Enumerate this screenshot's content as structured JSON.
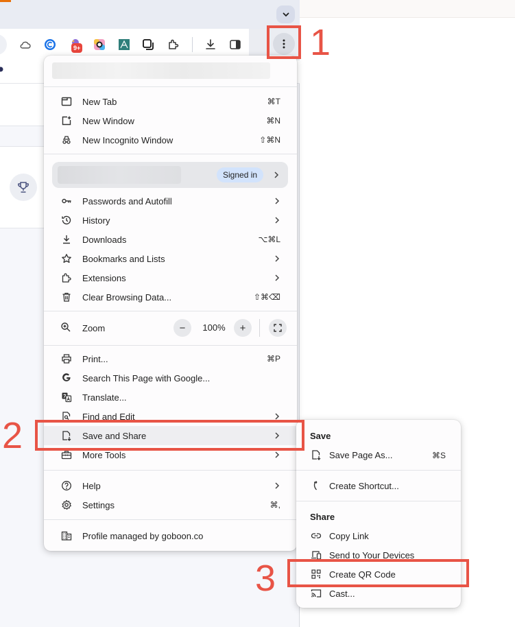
{
  "browser": {
    "tab_badge": "9+",
    "colors": {
      "annotation": "#e85446",
      "signed_pill": "#d2e3fc",
      "tab_accent": "#e8710a"
    }
  },
  "toolbar_icons": [
    "cloud-icon",
    "c-extension-icon",
    "notification-extension-icon",
    "color-picker-extension-icon",
    "asana-like-extension-icon",
    "window-copy-icon",
    "puzzle-extensions-icon",
    "download-icon",
    "side-panel-icon",
    "kebab-menu-icon"
  ],
  "menu": {
    "items_top": [
      {
        "label": "New Tab",
        "shortcut": "⌘T"
      },
      {
        "label": "New Window",
        "shortcut": "⌘N"
      },
      {
        "label": "New Incognito Window",
        "shortcut": "⇧⌘N"
      }
    ],
    "signed_in": "Signed in",
    "items_mid": [
      {
        "label": "Passwords and Autofill",
        "shortcut": ""
      },
      {
        "label": "History",
        "shortcut": ""
      },
      {
        "label": "Downloads",
        "shortcut": "⌥⌘L"
      },
      {
        "label": "Bookmarks and Lists",
        "shortcut": ""
      },
      {
        "label": "Extensions",
        "shortcut": ""
      },
      {
        "label": "Clear Browsing Data...",
        "shortcut": "⇧⌘⌫"
      }
    ],
    "zoom": {
      "label": "Zoom",
      "minus": "−",
      "value": "100%",
      "plus": "+"
    },
    "items_tools": [
      {
        "label": "Print...",
        "shortcut": "⌘P"
      },
      {
        "label": "Search This Page with Google...",
        "shortcut": ""
      },
      {
        "label": "Translate...",
        "shortcut": ""
      },
      {
        "label": "Find and Edit",
        "shortcut": ""
      },
      {
        "label": "Save and Share",
        "shortcut": ""
      },
      {
        "label": "More Tools",
        "shortcut": ""
      }
    ],
    "items_help": [
      {
        "label": "Help",
        "shortcut": ""
      },
      {
        "label": "Settings",
        "shortcut": "⌘,"
      }
    ],
    "managed": "Profile managed by goboon.co"
  },
  "submenu": {
    "save_heading": "Save",
    "save_page": {
      "label": "Save Page As...",
      "shortcut": "⌘S"
    },
    "create_shortcut": "Create Shortcut...",
    "share_heading": "Share",
    "copy_link": "Copy Link",
    "send_devices": "Send to Your Devices",
    "qr_code": "Create QR Code",
    "cast": "Cast..."
  },
  "annotations": {
    "step1": "1",
    "step2": "2",
    "step3": "3"
  }
}
